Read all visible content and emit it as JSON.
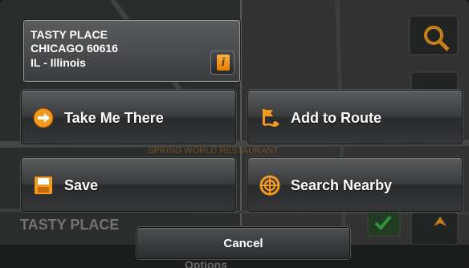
{
  "place": {
    "name": "TASTY PLACE",
    "city": "CHICAGO 60616",
    "state": "IL - Illinois"
  },
  "info_button": {
    "icon": "info-icon",
    "glyph": "i"
  },
  "actions": {
    "take_me_there": {
      "label": "Take Me There",
      "icon": "arrow-right-icon"
    },
    "add_to_route": {
      "label": "Add to Route",
      "icon": "route-flag-icon"
    },
    "save": {
      "label": "Save",
      "icon": "floppy-disk-icon"
    },
    "search_nearby": {
      "label": "Search Nearby",
      "icon": "target-icon"
    }
  },
  "cancel": {
    "label": "Cancel"
  },
  "background": {
    "place_label": "TASTY PLACE",
    "map_label": "SPRING WORLD RESTAURANT",
    "bottom_label": "Options"
  },
  "colors": {
    "accent_orange": "#f39a1e",
    "check_green": "#3bb34a"
  }
}
